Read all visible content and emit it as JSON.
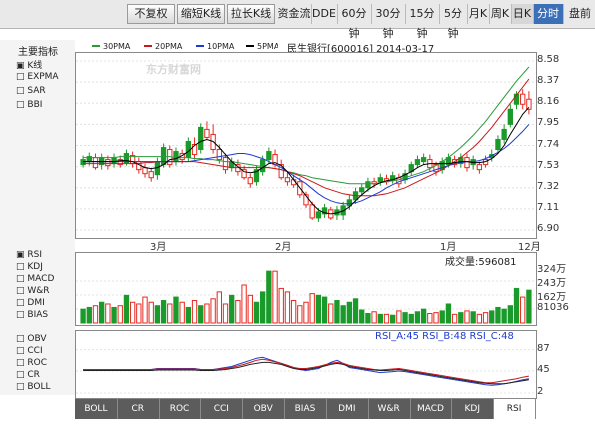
{
  "tabs": [
    {
      "label": "分时",
      "active": true
    },
    {
      "label": "日K",
      "active": false
    },
    {
      "label": "周K",
      "active": false
    },
    {
      "label": "月K",
      "active": false
    },
    {
      "label": "5分钟",
      "active": false
    },
    {
      "label": "15分钟",
      "active": false
    },
    {
      "label": "30分钟",
      "active": false
    },
    {
      "label": "60分钟",
      "active": false
    },
    {
      "label": "DDE",
      "active": false
    },
    {
      "label": "资金流",
      "active": false
    },
    {
      "label": "拉长K线",
      "active": false
    },
    {
      "label": "缩短K线",
      "active": false
    },
    {
      "label": "不复权",
      "active": false
    }
  ],
  "extra_tab": "盘前",
  "header": {
    "stock": "民生银行[600016] 2014-03-17",
    "ma_legend": [
      "5PMA",
      "10PMA",
      "20PMA",
      "30PMA"
    ],
    "main_indicator": "主要指标",
    "watermark": "东方财富网"
  },
  "left_panel": {
    "items": [
      "K线",
      "EXPMA",
      "SAR",
      "BBI"
    ],
    "sub_items": [
      "RSI",
      "KDJ",
      "MACD",
      "W&R",
      "DMI",
      "BIAS"
    ],
    "lower_items": [
      "OBV",
      "CCI",
      "ROC",
      "CR",
      "BOLL"
    ]
  },
  "volume_panel": {
    "label": "成交量:596081"
  },
  "rsi_panel": {
    "label": "RSI_A:45 RSI_B:48 RSI_C:48"
  },
  "bottom_tabs": [
    "RSI",
    "KDJ",
    "MACD",
    "W&R",
    "DMI",
    "BIAS",
    "OBV",
    "CCI",
    "ROC",
    "CR",
    "BOLL"
  ],
  "colors": {
    "up": "#e8271f",
    "down": "#1a9a2a",
    "ma5": "#000000",
    "ma10": "#1e3bd1",
    "ma20": "#c91818",
    "ma30": "#2a9a3a"
  },
  "chart_data": [
    {
      "type": "candlestick",
      "title": "民生银行[600016] 2014-03-17",
      "y_ticks": [
        8.58,
        8.37,
        8.16,
        7.95,
        7.74,
        7.53,
        7.32,
        7.11,
        6.9
      ],
      "ylim": [
        6.9,
        8.58
      ],
      "x_month_labels": [
        "3月",
        "2月",
        "1月",
        "12月"
      ],
      "series_order": "right-to-left (mirrored)",
      "closes": [
        8.2,
        8.25,
        8.15,
        7.95,
        7.8,
        7.7,
        7.62,
        7.6,
        7.55,
        7.55,
        7.62,
        7.56,
        7.6,
        7.55,
        7.5,
        7.55,
        7.6,
        7.58,
        7.55,
        7.48,
        7.4,
        7.42,
        7.4,
        7.41,
        7.38,
        7.38,
        7.32,
        7.28,
        7.2,
        7.14,
        7.05,
        7.05,
        7.1,
        7.06,
        7.02,
        7.15,
        7.25,
        7.38,
        7.4,
        7.42,
        7.55,
        7.65,
        7.6,
        7.48,
        7.38,
        7.42,
        7.5,
        7.55,
        7.52,
        7.62,
        7.7,
        7.85,
        7.9,
        7.7,
        7.75,
        7.62,
        7.66,
        7.58,
        7.7,
        7.55,
        7.45,
        7.48,
        7.52,
        7.58,
        7.64,
        7.57,
        7.6,
        7.56,
        7.6,
        7.55,
        7.62,
        7.58,
        7.55
      ],
      "opens": [
        8.1,
        8.15,
        8.25,
        8.1,
        7.9,
        7.8,
        7.65,
        7.55,
        7.5,
        7.6,
        7.52,
        7.62,
        7.55,
        7.62,
        7.58,
        7.48,
        7.52,
        7.62,
        7.6,
        7.55,
        7.46,
        7.36,
        7.44,
        7.38,
        7.42,
        7.36,
        7.38,
        7.32,
        7.28,
        7.2,
        7.14,
        7.1,
        7.02,
        7.12,
        7.08,
        7.02,
        7.15,
        7.25,
        7.35,
        7.38,
        7.42,
        7.55,
        7.68,
        7.6,
        7.5,
        7.36,
        7.42,
        7.48,
        7.58,
        7.5,
        7.6,
        7.7,
        7.82,
        7.92,
        7.65,
        7.78,
        7.6,
        7.68,
        7.55,
        7.72,
        7.58,
        7.42,
        7.46,
        7.5,
        7.56,
        7.66,
        7.55,
        7.62,
        7.54,
        7.62,
        7.52,
        7.63,
        7.6
      ],
      "highs": [
        8.28,
        8.3,
        8.28,
        8.15,
        7.95,
        7.84,
        7.7,
        7.64,
        7.58,
        7.64,
        7.66,
        7.66,
        7.64,
        7.66,
        7.62,
        7.58,
        7.65,
        7.66,
        7.64,
        7.58,
        7.5,
        7.46,
        7.48,
        7.45,
        7.46,
        7.42,
        7.42,
        7.36,
        7.32,
        7.25,
        7.18,
        7.14,
        7.13,
        7.16,
        7.12,
        7.18,
        7.28,
        7.42,
        7.45,
        7.48,
        7.6,
        7.7,
        7.72,
        7.64,
        7.54,
        7.46,
        7.54,
        7.6,
        7.62,
        7.66,
        7.75,
        7.95,
        7.98,
        7.96,
        7.82,
        7.82,
        7.7,
        7.72,
        7.74,
        7.76,
        7.62,
        7.52,
        7.56,
        7.62,
        7.68,
        7.7,
        7.64,
        7.66,
        7.64,
        7.66,
        7.66,
        7.67,
        7.64
      ],
      "lows": [
        8.05,
        8.1,
        8.1,
        7.92,
        7.76,
        7.66,
        7.58,
        7.52,
        7.46,
        7.5,
        7.48,
        7.52,
        7.52,
        7.52,
        7.46,
        7.44,
        7.48,
        7.55,
        7.52,
        7.44,
        7.36,
        7.32,
        7.36,
        7.35,
        7.34,
        7.32,
        7.28,
        7.24,
        7.16,
        7.1,
        7.0,
        7.0,
        7.0,
        7.02,
        6.98,
        7.0,
        7.12,
        7.22,
        7.32,
        7.34,
        7.4,
        7.52,
        7.56,
        7.44,
        7.34,
        7.32,
        7.4,
        7.44,
        7.48,
        7.46,
        7.56,
        7.66,
        7.8,
        7.66,
        7.6,
        7.58,
        7.56,
        7.54,
        7.52,
        7.52,
        7.4,
        7.38,
        7.42,
        7.46,
        7.52,
        7.54,
        7.52,
        7.52,
        7.5,
        7.5,
        7.5,
        7.54,
        7.52
      ],
      "ma5": [
        8.12,
        8.05,
        7.95,
        7.85,
        7.74,
        7.66,
        7.61,
        7.58,
        7.57,
        7.57,
        7.58,
        7.58,
        7.57,
        7.56,
        7.56,
        7.56,
        7.56,
        7.55,
        7.52,
        7.48,
        7.45,
        7.42,
        7.4,
        7.39,
        7.37,
        7.34,
        7.3,
        7.25,
        7.19,
        7.13,
        7.09,
        7.07,
        7.06,
        7.07,
        7.1,
        7.16,
        7.24,
        7.32,
        7.4,
        7.48,
        7.54,
        7.57,
        7.56,
        7.52,
        7.48,
        7.47,
        7.48,
        7.53,
        7.58,
        7.65,
        7.72,
        7.78,
        7.8,
        7.78,
        7.74,
        7.68,
        7.64,
        7.61,
        7.6,
        7.55,
        7.52,
        7.51,
        7.52,
        7.55,
        7.58,
        7.59,
        7.59,
        7.58,
        7.58,
        7.58,
        7.58,
        7.58,
        7.58
      ],
      "ma10": [
        7.95,
        7.88,
        7.82,
        7.76,
        7.71,
        7.67,
        7.64,
        7.61,
        7.59,
        7.58,
        7.58,
        7.57,
        7.56,
        7.54,
        7.52,
        7.5,
        7.48,
        7.46,
        7.44,
        7.42,
        7.4,
        7.38,
        7.35,
        7.32,
        7.28,
        7.25,
        7.22,
        7.19,
        7.17,
        7.16,
        7.16,
        7.17,
        7.19,
        7.22,
        7.26,
        7.31,
        7.36,
        7.4,
        7.44,
        7.48,
        7.52,
        7.55,
        7.58,
        7.61,
        7.63,
        7.65,
        7.66,
        7.66,
        7.65,
        7.64,
        7.63,
        7.62,
        7.61,
        7.6,
        7.59,
        7.58,
        7.58,
        7.58,
        7.58,
        7.58,
        7.58,
        7.58,
        7.58,
        7.58,
        7.58,
        7.58,
        7.58,
        7.58,
        7.58,
        7.58,
        7.58,
        7.58,
        7.58
      ],
      "ma20": [
        8.4,
        8.32,
        8.24,
        8.16,
        8.08,
        8.0,
        7.92,
        7.85,
        7.78,
        7.72,
        7.67,
        7.62,
        7.58,
        7.54,
        7.5,
        7.47,
        7.44,
        7.41,
        7.38,
        7.35,
        7.32,
        7.3,
        7.28,
        7.26,
        7.25,
        7.24,
        7.24,
        7.24,
        7.24,
        7.25,
        7.26,
        7.28,
        7.3,
        7.32,
        7.35,
        7.38,
        7.41,
        7.44,
        7.46,
        7.48,
        7.5,
        7.51,
        7.52,
        7.52,
        7.52,
        7.52,
        7.52,
        7.52,
        7.52,
        7.53,
        7.54,
        7.55,
        7.56,
        7.57,
        7.58,
        7.58,
        7.58,
        7.58,
        7.58,
        7.58,
        7.58,
        7.57,
        7.57,
        7.56,
        7.56,
        7.56,
        7.56,
        7.56,
        7.56,
        7.56,
        7.56,
        7.56,
        7.56
      ],
      "ma30": [
        8.52,
        8.45,
        8.38,
        8.3,
        8.22,
        8.14,
        8.06,
        7.98,
        7.91,
        7.84,
        7.78,
        7.72,
        7.67,
        7.62,
        7.58,
        7.54,
        7.51,
        7.48,
        7.46,
        7.44,
        7.42,
        7.4,
        7.39,
        7.38,
        7.37,
        7.36,
        7.36,
        7.36,
        7.36,
        7.36,
        7.37,
        7.38,
        7.39,
        7.4,
        7.41,
        7.42,
        7.44,
        7.45,
        7.47,
        7.48,
        7.5,
        7.51,
        7.52,
        7.53,
        7.54,
        7.55,
        7.56,
        7.57,
        7.58,
        7.58,
        7.59,
        7.6,
        7.6,
        7.61,
        7.61,
        7.62,
        7.62,
        7.62,
        7.63,
        7.63,
        7.63,
        7.63,
        7.63,
        7.63,
        7.63,
        7.63,
        7.63,
        7.62,
        7.62,
        7.62,
        7.62,
        7.62,
        7.62
      ]
    },
    {
      "type": "bar",
      "title": "成交量:596081",
      "y_ticks": [
        "324万",
        "243万",
        "162万",
        "81036"
      ],
      "ylim": [
        0,
        3240000
      ],
      "values": [
        1900000,
        1500000,
        2000000,
        1000000,
        800000,
        900000,
        700000,
        600000,
        500000,
        650000,
        700000,
        600000,
        500000,
        1100000,
        700000,
        600000,
        550000,
        800000,
        650000,
        500000,
        600000,
        700000,
        450000,
        500000,
        500000,
        650000,
        550000,
        750000,
        1400000,
        1200000,
        1000000,
        1300000,
        1100000,
        1500000,
        1600000,
        1700000,
        1200000,
        1000000,
        1300000,
        1800000,
        2000000,
        3000000,
        3000000,
        1800000,
        1200000,
        1600000,
        2200000,
        1300000,
        1600000,
        1100000,
        1800000,
        1400000,
        1100000,
        1000000,
        1300000,
        900000,
        1200000,
        1500000,
        1100000,
        1300000,
        1000000,
        1200000,
        1500000,
        1100000,
        1200000,
        1600000,
        1000000,
        900000,
        1100000,
        1200000,
        1000000,
        900000,
        800000
      ],
      "up_flags": [
        0,
        1,
        0,
        0,
        0,
        0,
        0,
        1,
        1,
        0,
        1,
        0,
        1,
        0,
        0,
        1,
        1,
        0,
        0,
        0,
        0,
        1,
        0,
        1,
        0,
        1,
        0,
        0,
        0,
        0,
        0,
        0,
        1,
        0,
        0,
        1,
        1,
        1,
        1,
        1,
        1,
        1,
        0,
        0,
        0,
        1,
        1,
        1,
        0,
        1,
        1,
        1,
        1,
        0,
        1,
        0,
        1,
        0,
        1,
        0,
        0,
        1,
        1,
        1,
        1,
        0,
        1,
        0,
        1,
        0,
        1,
        0,
        0
      ]
    },
    {
      "type": "line",
      "title": "RSI_A:45 RSI_B:48 RSI_C:48",
      "y_ticks": [
        87,
        45,
        2
      ],
      "ylim": [
        0,
        100
      ],
      "series": [
        {
          "name": "RSI_A",
          "values": [
            30,
            28,
            25,
            22,
            20,
            18,
            17,
            18,
            20,
            22,
            24,
            26,
            28,
            30,
            32,
            34,
            36,
            38,
            40,
            42,
            44,
            45,
            44,
            43,
            42,
            44,
            46,
            48,
            50,
            52,
            60,
            66,
            62,
            56,
            50,
            48,
            46,
            48,
            52,
            56,
            60,
            64,
            68,
            72,
            70,
            66,
            62,
            58,
            54,
            52,
            50,
            48,
            48,
            48,
            50,
            50,
            50,
            50,
            50,
            50,
            50,
            48,
            48,
            48,
            48,
            48,
            48,
            48,
            48,
            48,
            48,
            48,
            48
          ]
        },
        {
          "name": "RSI_B",
          "values": [
            35,
            33,
            30,
            28,
            26,
            24,
            22,
            22,
            24,
            26,
            28,
            30,
            32,
            34,
            36,
            38,
            40,
            42,
            44,
            46,
            48,
            50,
            49,
            48,
            47,
            48,
            50,
            52,
            54,
            56,
            60,
            62,
            60,
            57,
            54,
            52,
            50,
            50,
            52,
            56,
            60,
            63,
            66,
            68,
            66,
            62,
            58,
            55,
            52,
            50,
            49,
            48,
            48,
            48,
            49,
            49,
            49,
            49,
            49,
            49,
            49,
            48,
            48,
            48,
            48,
            48,
            48,
            48,
            48,
            48,
            48,
            48,
            48
          ]
        },
        {
          "name": "RSI_C",
          "values": [
            28,
            26,
            24,
            22,
            20,
            20,
            20,
            21,
            22,
            24,
            26,
            28,
            30,
            32,
            34,
            36,
            38,
            40,
            42,
            44,
            46,
            48,
            47,
            46,
            46,
            47,
            48,
            50,
            52,
            54,
            58,
            60,
            58,
            55,
            52,
            50,
            48,
            48,
            50,
            54,
            58,
            60,
            62,
            62,
            60,
            58,
            55,
            52,
            50,
            48,
            47,
            46,
            46,
            46,
            47,
            47,
            47,
            47,
            47,
            47,
            47,
            46,
            46,
            46,
            46,
            46,
            46,
            46,
            46,
            46,
            46,
            46,
            46
          ]
        }
      ]
    }
  ]
}
